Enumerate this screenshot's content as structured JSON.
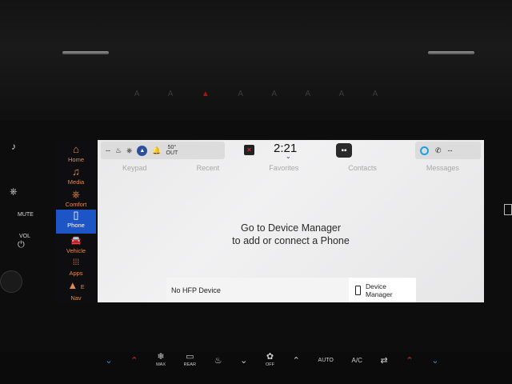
{
  "hvac_strip": [
    "A",
    "A",
    "▲",
    "A",
    "A",
    "A",
    "A",
    "A"
  ],
  "left_keys": {
    "mute": "MUTE",
    "vol": "VOL"
  },
  "rail": [
    {
      "icon": "⌂",
      "label": "Home",
      "name": "home"
    },
    {
      "icon": "♫",
      "label": "Media",
      "name": "media"
    },
    {
      "icon": "⎈",
      "label": "Comfort",
      "name": "comfort"
    },
    {
      "icon": "▯",
      "label": "Phone",
      "name": "phone",
      "active": true
    },
    {
      "icon": "🚘",
      "label": "Vehicle",
      "name": "vehicle"
    },
    {
      "icon": "⁞⁞⁞",
      "label": "Apps",
      "name": "apps"
    },
    {
      "icon": "▲",
      "label": "Nav",
      "name": "nav"
    }
  ],
  "rail_compass": "E",
  "status": {
    "left_dash": "--",
    "temp_value": "50°",
    "temp_label": "OUT",
    "clock": "2:21",
    "right_dash": "--"
  },
  "tabs": [
    "Keypad",
    "Recent",
    "Favorites",
    "Contacts",
    "Messages"
  ],
  "message": {
    "line1": "Go to Device Manager",
    "line2": "to add or connect a Phone"
  },
  "bottom": {
    "hfp": "No HFP Device",
    "device_manager": "Device Manager"
  },
  "climate": [
    {
      "glyph": "⌄",
      "label": "",
      "cls": "blue",
      "name": "temp-down-left"
    },
    {
      "glyph": "⌃",
      "label": "",
      "cls": "redc",
      "name": "temp-up-left"
    },
    {
      "glyph": "❄",
      "label": "MAX",
      "cls": "",
      "name": "max-defrost"
    },
    {
      "glyph": "▭",
      "label": "REAR",
      "cls": "",
      "name": "rear-defrost"
    },
    {
      "glyph": "♨",
      "label": "",
      "cls": "",
      "name": "seat-heat"
    },
    {
      "glyph": "⌄",
      "label": "",
      "cls": "",
      "name": "fan-down"
    },
    {
      "glyph": "✿",
      "label": "OFF",
      "cls": "",
      "name": "fan-off"
    },
    {
      "glyph": "⌃",
      "label": "",
      "cls": "",
      "name": "fan-up"
    },
    {
      "glyph": "AUTO",
      "label": "",
      "cls": "",
      "name": "auto"
    },
    {
      "glyph": "A/C",
      "label": "",
      "cls": "",
      "name": "ac"
    },
    {
      "glyph": "⇄",
      "label": "",
      "cls": "",
      "name": "recirc"
    },
    {
      "glyph": "⌃",
      "label": "",
      "cls": "redc",
      "name": "temp-up-right"
    },
    {
      "glyph": "⌄",
      "label": "",
      "cls": "blue",
      "name": "temp-down-right"
    }
  ]
}
